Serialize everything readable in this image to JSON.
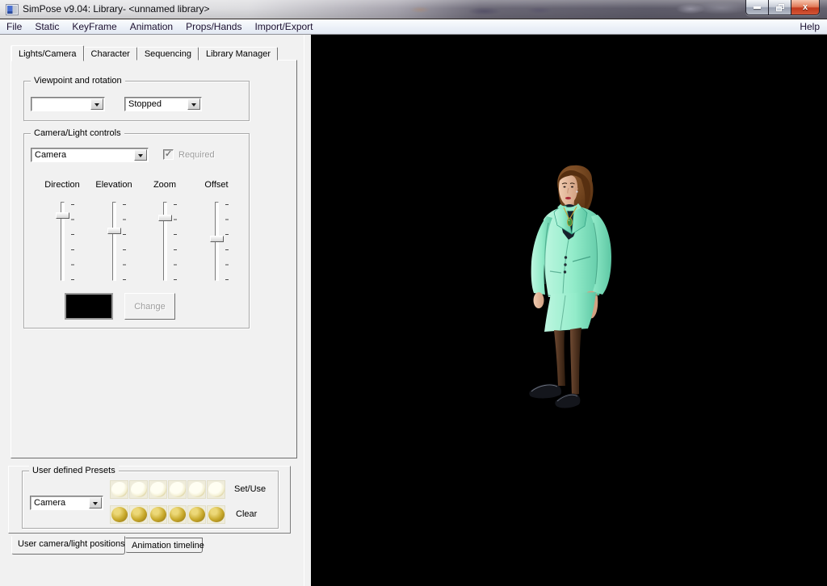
{
  "window": {
    "title": "SimPose v9.04: Library- <unnamed library>"
  },
  "menubar": {
    "items": [
      "File",
      "Static",
      "KeyFrame",
      "Animation",
      "Props/Hands",
      "Import/Export"
    ],
    "help": "Help"
  },
  "tabs": [
    {
      "label": "Lights/Camera",
      "active": true
    },
    {
      "label": "Character",
      "active": false
    },
    {
      "label": "Sequencing",
      "active": false
    },
    {
      "label": "Library Manager",
      "active": false
    }
  ],
  "page": {
    "viewpoint": {
      "title": "Viewpoint and rotation",
      "viewpoint_value": "",
      "rotation_value": "Stopped"
    },
    "camera": {
      "title": "Camera/Light controls",
      "target_value": "Camera",
      "required_label": "Required",
      "required_checked": true,
      "sliders": [
        {
          "label": "Direction",
          "position": 0.14
        },
        {
          "label": "Elevation",
          "position": 0.36
        },
        {
          "label": "Zoom",
          "position": 0.18
        },
        {
          "label": "Offset",
          "position": 0.47
        }
      ],
      "swatch_color": "#000000",
      "change_label": "Change",
      "change_enabled": false
    }
  },
  "presets": {
    "title": "User defined Presets",
    "target_value": "Camera",
    "set_label": "Set/Use",
    "clear_label": "Clear",
    "slots_per_row": 6
  },
  "bottom_tabs": [
    {
      "label": "User camera/light positions",
      "active": true
    },
    {
      "label": "Animation timeline",
      "active": false
    }
  ],
  "viewport": {
    "background": "#000000",
    "character_colors": {
      "suit_light": "#bdf6e0",
      "suit_mid": "#93ecca",
      "suit_dark": "#5dc7a4",
      "suit_line": "#2f9e80",
      "skin_light": "#f0cbb0",
      "skin_dark": "#d2a182",
      "hair_light": "#8d5a2e",
      "hair_dark": "#552e0f",
      "shirt": "#17202c",
      "leg_light": "#6f4a32",
      "leg_dark": "#2f1c0e",
      "shoe": "#14161c",
      "lip": "#ab2f3c",
      "pendant": "#3f8f3f",
      "gold": "#c9a23a"
    }
  }
}
